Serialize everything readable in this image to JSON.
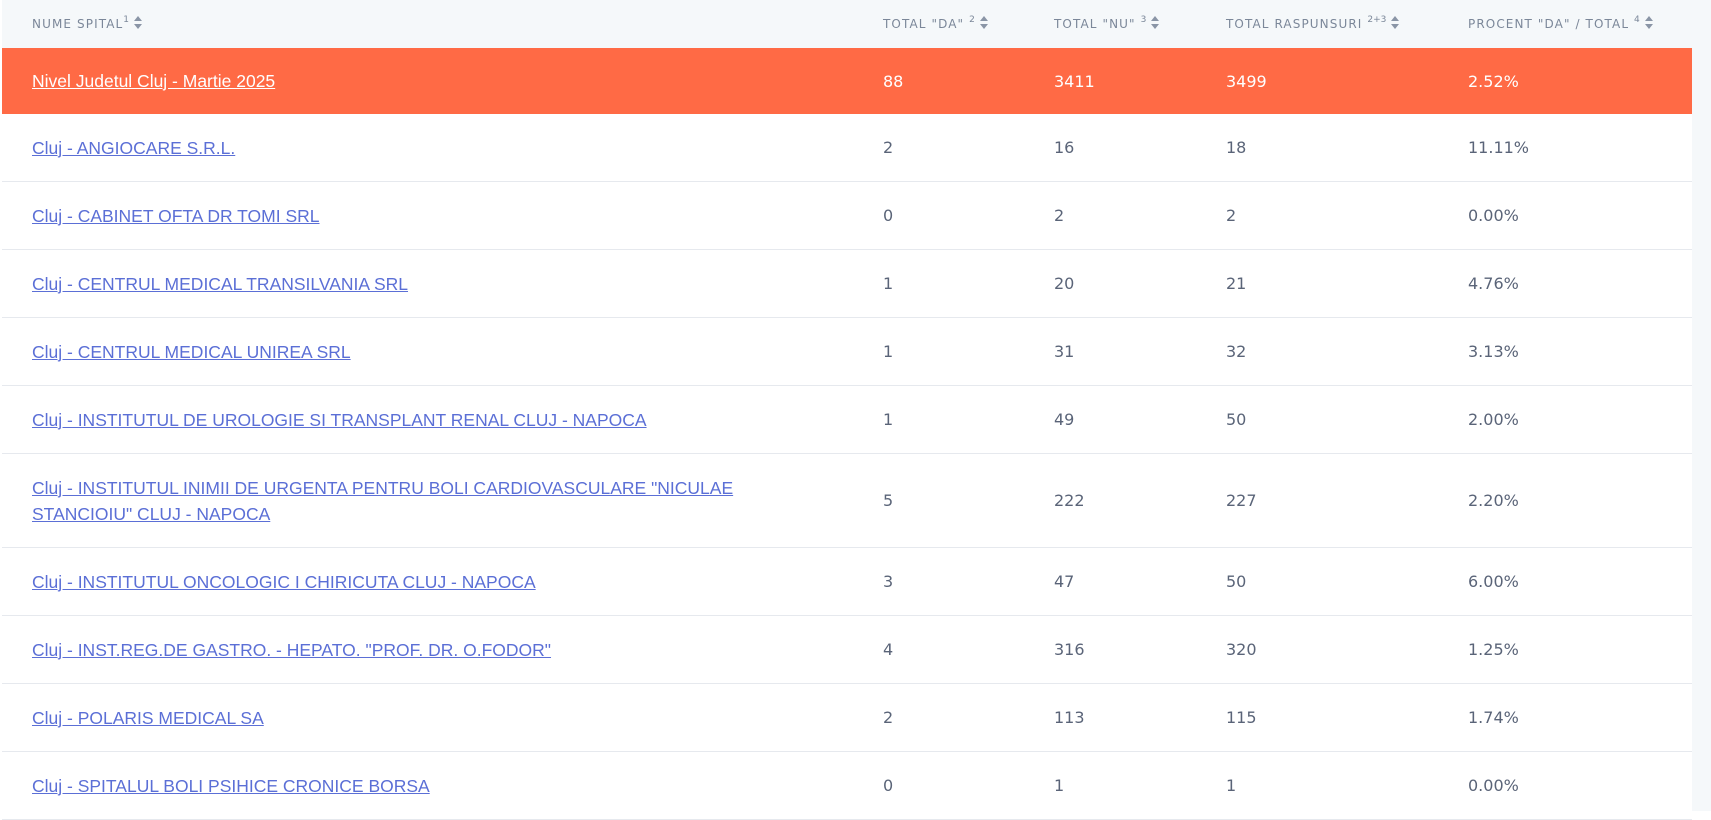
{
  "columns": [
    {
      "label": "Nume spital",
      "sup": "1"
    },
    {
      "label": "Total \"DA\"",
      "sup": "2"
    },
    {
      "label": "Total \"NU\"",
      "sup": "3"
    },
    {
      "label": "Total raspunsuri",
      "sup": "2+3"
    },
    {
      "label": "Procent \"DA\" / Total",
      "sup": "4"
    }
  ],
  "rows": [
    {
      "name": "Nivel Judetul Cluj - Martie 2025",
      "da": "88",
      "nu": "3411",
      "total": "3499",
      "pct": "2.52%"
    },
    {
      "name": "Cluj - ANGIOCARE S.R.L.",
      "da": "2",
      "nu": "16",
      "total": "18",
      "pct": "11.11%"
    },
    {
      "name": "Cluj - CABINET OFTA DR TOMI SRL",
      "da": "0",
      "nu": "2",
      "total": "2",
      "pct": "0.00%"
    },
    {
      "name": "Cluj - CENTRUL MEDICAL TRANSILVANIA SRL",
      "da": "1",
      "nu": "20",
      "total": "21",
      "pct": "4.76%"
    },
    {
      "name": "Cluj - CENTRUL MEDICAL UNIREA SRL",
      "da": "1",
      "nu": "31",
      "total": "32",
      "pct": "3.13%"
    },
    {
      "name": "Cluj - INSTITUTUL DE UROLOGIE SI TRANSPLANT RENAL CLUJ - NAPOCA",
      "da": "1",
      "nu": "49",
      "total": "50",
      "pct": "2.00%"
    },
    {
      "name": "Cluj - INSTITUTUL INIMII DE URGENTA PENTRU BOLI CARDIOVASCULARE \"NICULAE STANCIOIU\" CLUJ - NAPOCA",
      "da": "5",
      "nu": "222",
      "total": "227",
      "pct": "2.20%"
    },
    {
      "name": "Cluj - INSTITUTUL ONCOLOGIC I CHIRICUTA CLUJ - NAPOCA",
      "da": "3",
      "nu": "47",
      "total": "50",
      "pct": "6.00%"
    },
    {
      "name": "Cluj - INST.REG.DE GASTRO. - HEPATO. \"PROF. DR. O.FODOR\"",
      "da": "4",
      "nu": "316",
      "total": "320",
      "pct": "1.25%"
    },
    {
      "name": "Cluj - POLARIS MEDICAL SA",
      "da": "2",
      "nu": "113",
      "total": "115",
      "pct": "1.74%"
    },
    {
      "name": "Cluj - SPITALUL BOLI PSIHICE CRONICE BORSA",
      "da": "0",
      "nu": "1",
      "total": "1",
      "pct": "0.00%"
    }
  ],
  "colors": {
    "highlight": "#ff6a45",
    "link": "#5b6fd6",
    "header_bg": "#f5f8fa"
  },
  "icons": {
    "sort": "sort-arrows-icon"
  }
}
